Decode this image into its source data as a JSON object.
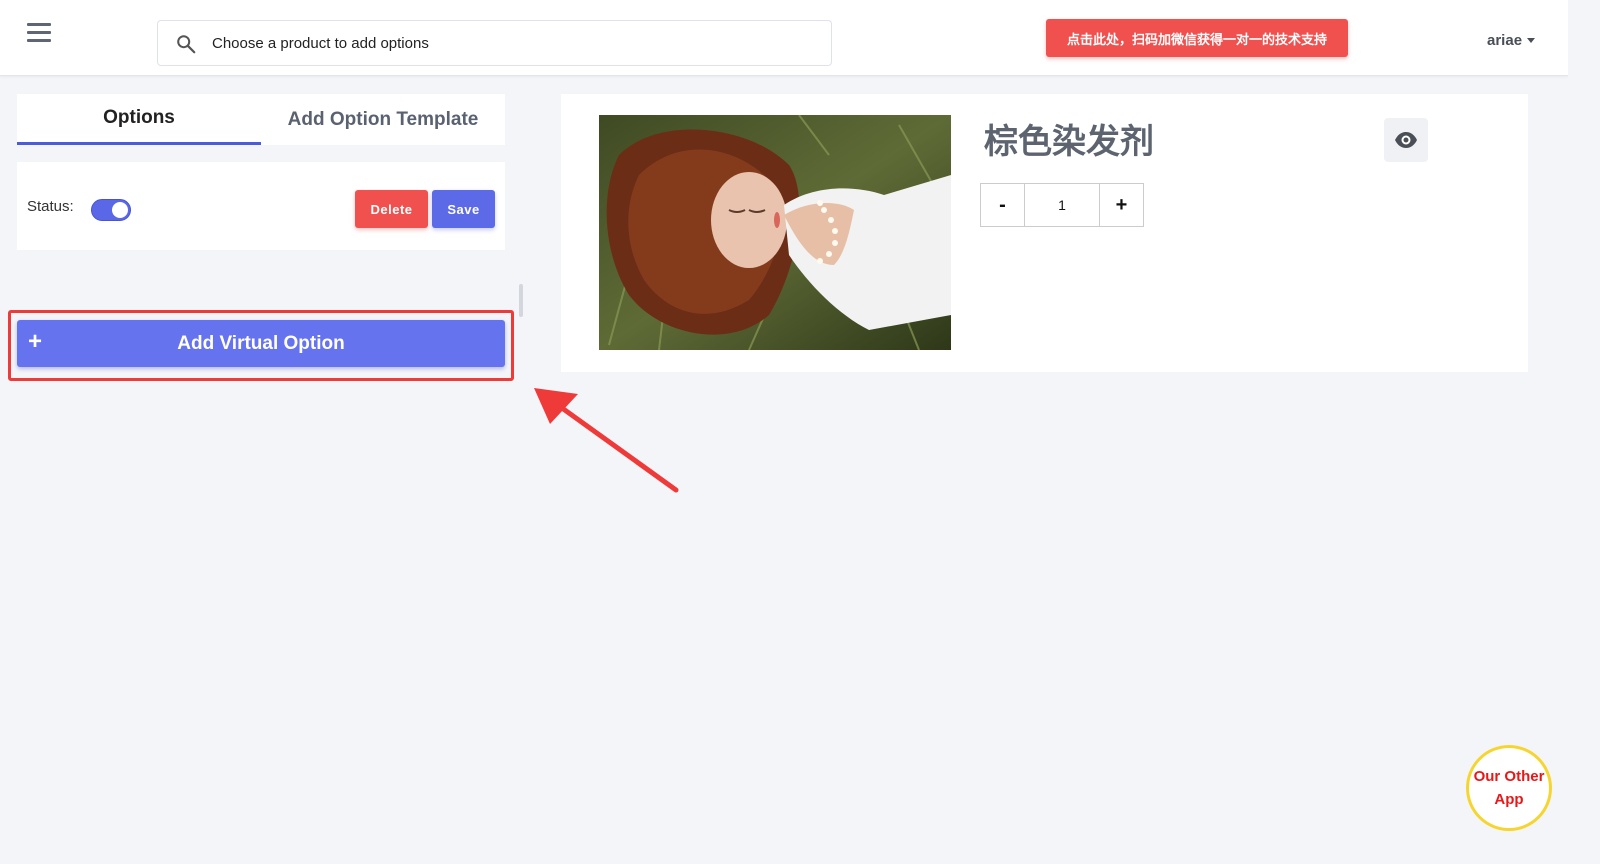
{
  "header": {
    "search_placeholder": "Choose a product to add options",
    "support_button": "点击此处，扫码加微信获得一对一的技术支持",
    "user_name": "ariae"
  },
  "tabs": [
    {
      "label": "Options",
      "active": true
    },
    {
      "label": "Add Option Template",
      "active": false
    }
  ],
  "status_card": {
    "status_label": "Status:",
    "status_on": true,
    "delete_label": "Delete",
    "save_label": "Save"
  },
  "add_virtual_option": {
    "plus": "+",
    "label": "Add Virtual Option"
  },
  "product": {
    "title": "棕色染发剂",
    "quantity": "1",
    "minus": "-",
    "plus": "+"
  },
  "other_app": {
    "line1": "Our Other",
    "line2": "App"
  },
  "colors": {
    "accent": "#5c6ae8",
    "danger": "#f0514e",
    "highlight": "#ef3a3a",
    "badge_ring": "#f6d531"
  }
}
